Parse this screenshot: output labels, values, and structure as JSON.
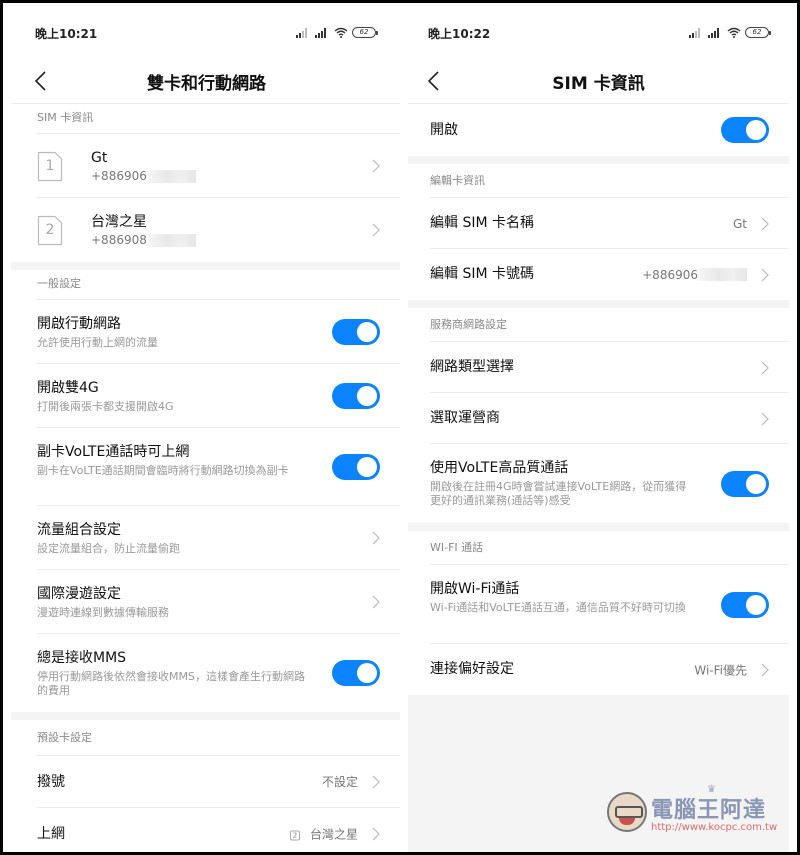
{
  "left": {
    "status_bar": {
      "time": "晚上10:21",
      "battery": "62"
    },
    "title": "雙卡和行動網路",
    "sim_section": {
      "header": "SIM 卡資訊",
      "cards": [
        {
          "slot": "1",
          "name": "Gt",
          "number": "+886906"
        },
        {
          "slot": "2",
          "name": "台灣之星",
          "number": "+886908"
        }
      ]
    },
    "general_section": {
      "header": "一般設定",
      "items": [
        {
          "title": "開啟行動網路",
          "subtitle": "允許使用行動上網的流量",
          "control": "toggle",
          "on": true
        },
        {
          "title": "開啟雙4G",
          "subtitle": "打開後兩張卡都支援開啟4G",
          "control": "toggle",
          "on": true
        },
        {
          "title": "副卡VoLTE通話時可上網",
          "subtitle": "副卡在VoLTE通話期間會臨時將行動網路切換為副卡",
          "control": "toggle",
          "on": true
        },
        {
          "title": "流量組合設定",
          "subtitle": "設定流量組合，防止流量偷跑",
          "control": "chevron"
        },
        {
          "title": "國際漫遊設定",
          "subtitle": "漫遊時連線到數據傳輸服務",
          "control": "chevron"
        },
        {
          "title": "總是接收MMS",
          "subtitle": "停用行動網路後依然會接收MMS，這樣會產生行動網路的費用",
          "control": "toggle",
          "on": true
        }
      ]
    },
    "default_section": {
      "header": "預設卡設定",
      "items": [
        {
          "title": "撥號",
          "value": "不設定"
        },
        {
          "title": "上網",
          "value": "台灣之星",
          "value_tag": "2"
        }
      ]
    }
  },
  "right": {
    "status_bar": {
      "time": "晚上10:22",
      "battery": "62"
    },
    "title": "SIM 卡資訊",
    "enable_row": {
      "title": "開啟",
      "on": true
    },
    "edit_section": {
      "header": "編輯卡資訊",
      "items": [
        {
          "title": "編輯 SIM 卡名稱",
          "value": "Gt"
        },
        {
          "title": "編輯 SIM 卡號碼",
          "value": "+886906"
        }
      ]
    },
    "carrier_section": {
      "header": "服務商網路設定",
      "items": [
        {
          "title": "網路類型選擇"
        },
        {
          "title": "選取運營商"
        },
        {
          "title": "使用VoLTE高品質通話",
          "subtitle": "開啟後在註冊4G時會嘗試連接VoLTE網路，從而獲得更好的通訊業務(通話等)感受",
          "on": true
        }
      ]
    },
    "wifi_section": {
      "header": "WI-FI 通話",
      "items": [
        {
          "title": "開啟Wi-Fi通話",
          "subtitle": "Wi-Fi通話和VoLTE通話互通，通信品質不好時可切換",
          "on": true
        },
        {
          "title": "連接偏好設定",
          "value": "Wi-Fi優先"
        }
      ]
    }
  },
  "watermark": {
    "title": "電腦王阿達",
    "url": "http://www.kocpc.com.tw"
  },
  "colors": {
    "accent": "#0d84ff",
    "section_bg": "#f4f4f4"
  }
}
